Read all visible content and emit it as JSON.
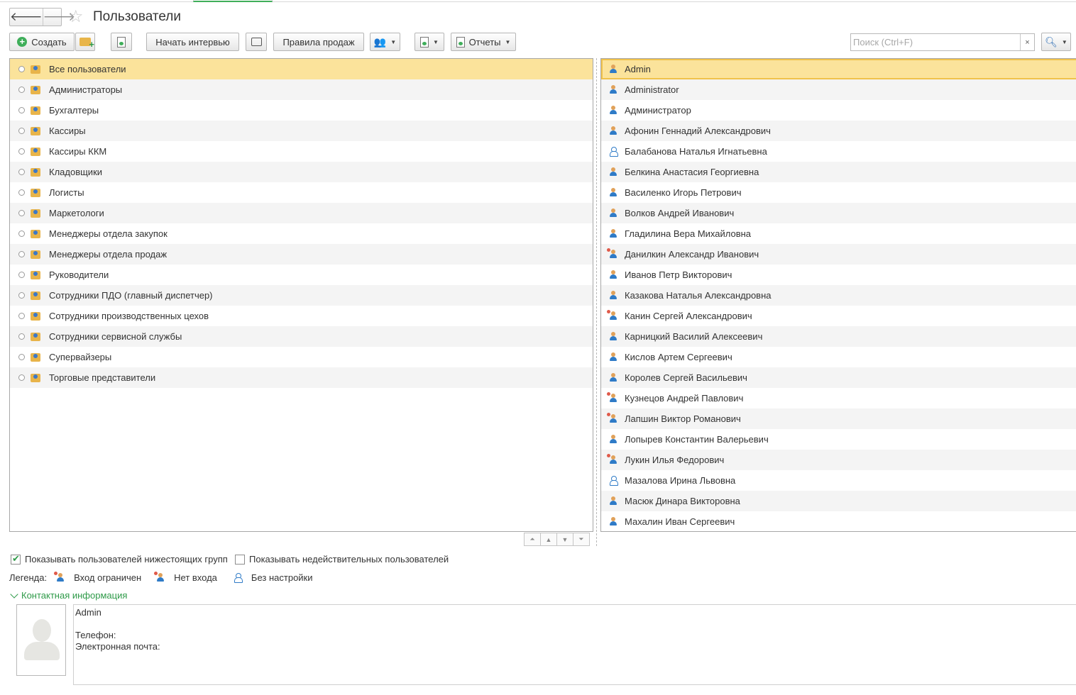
{
  "window": {
    "title": "Пользователи"
  },
  "nav": {
    "back": "🡐",
    "forward": "🡒",
    "favorite": "☆"
  },
  "toolbar": {
    "create": "Создать",
    "interview": "Начать интервью",
    "sales_rules": "Правила продаж",
    "reports": "Отчеты"
  },
  "search": {
    "placeholder": "Поиск (Ctrl+F)",
    "value": "",
    "clear": "×"
  },
  "groups": [
    "Все пользователи",
    "Администраторы",
    "Бухгалтеры",
    "Кассиры",
    "Кассиры ККМ",
    "Кладовщики",
    "Логисты",
    "Маркетологи",
    "Менеджеры отдела закупок",
    "Менеджеры отдела продаж",
    "Руководители",
    "Сотрудники ПДО (главный диспетчер)",
    "Сотрудники производственных цехов",
    "Сотрудники сервисной службы",
    "Супервайзеры",
    "Торговые представители"
  ],
  "users": [
    "Admin",
    "Administrator",
    "Администратор",
    "Афонин Геннадий Александрович",
    "Балабанова Наталья Игнатьевна",
    "Белкина Анастасия Георгиевна",
    "Василенко Игорь Петрович",
    "Волков Андрей Иванович",
    "Гладилина Вера Михайловна",
    "Данилкин Александр Иванович",
    "Иванов Петр Викторович",
    "Казакова Наталья Александровна",
    "Канин Сергей Александрович",
    "Карницкий Василий Алексеевич",
    "Кислов Артем Сергеевич",
    "Королев Сергей Васильевич",
    "Кузнецов Андрей Павлович",
    "Лапшин Виктор Романович",
    "Лопырев Константин Валерьевич",
    "Лукин Илья Федорович",
    "Мазалова Ирина Львовна",
    "Масюк Динара Викторовна",
    "Махалин Иван Сергеевич"
  ],
  "options": {
    "show_subgroups": "Показывать пользователей нижестоящих групп",
    "show_inactive": "Показывать недействительных пользователей"
  },
  "legend": {
    "label": "Легенда:",
    "restricted": "Вход ограничен",
    "no_login": "Нет входа",
    "no_setup": "Без настройки"
  },
  "contacts": {
    "header": "Контактная информация",
    "name": "Admin",
    "phone": "Телефон:",
    "email": "Электронная почта:"
  }
}
